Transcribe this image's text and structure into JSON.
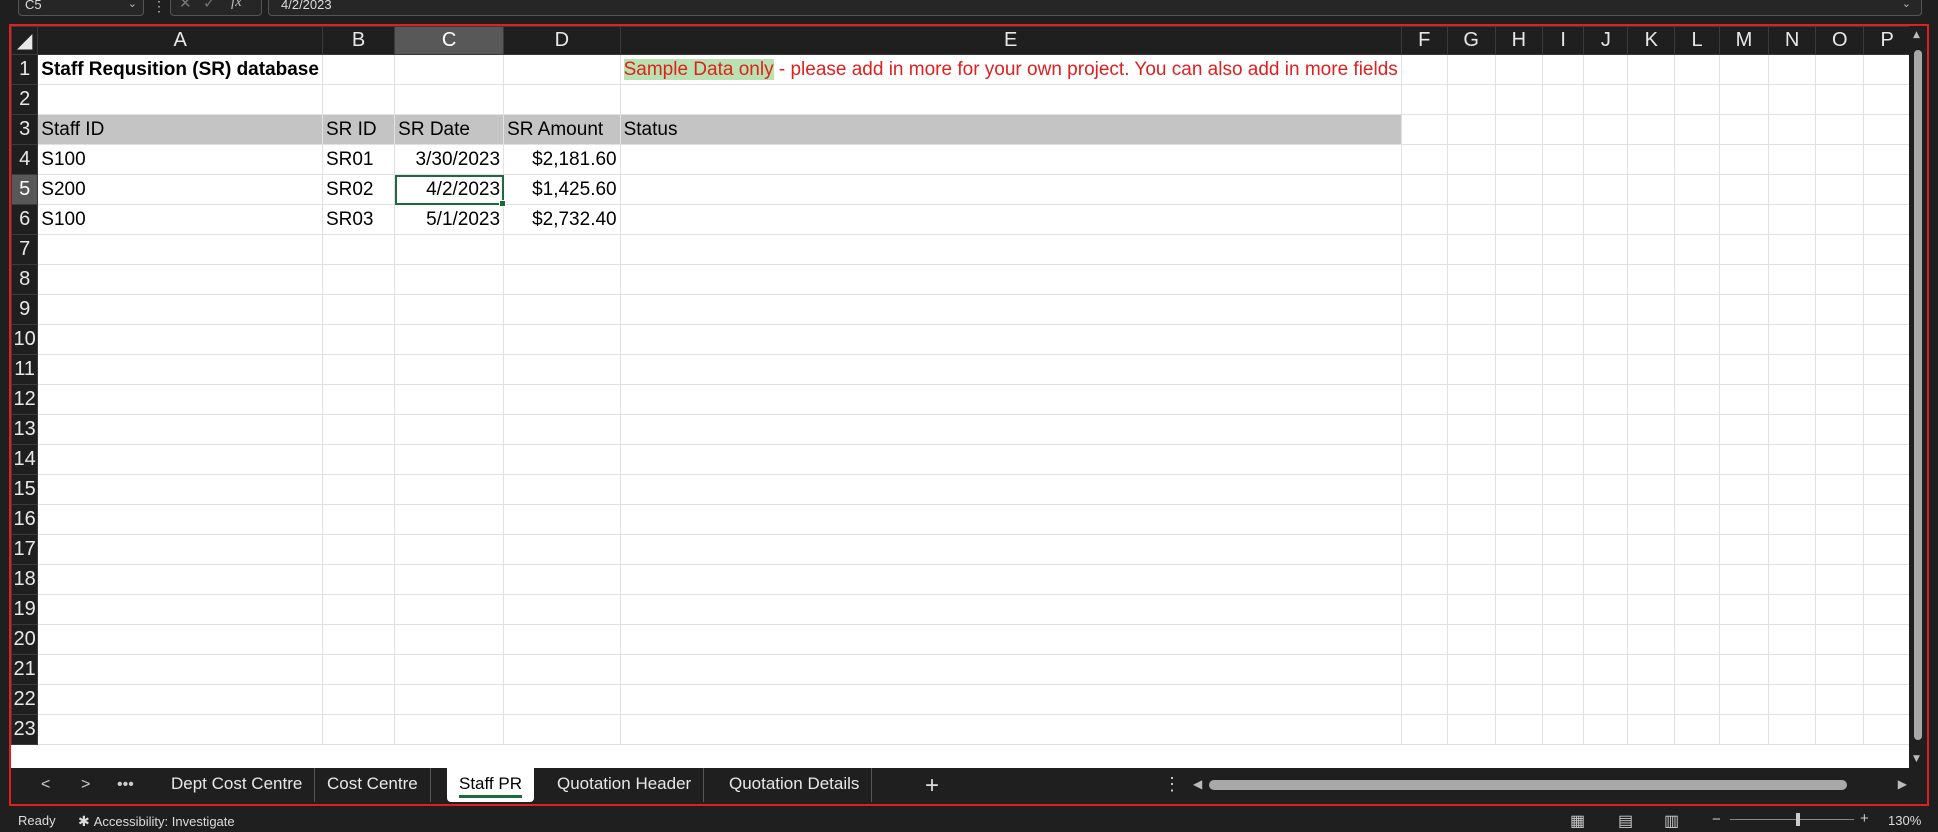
{
  "formula_bar": {
    "name_box": "C5",
    "cancel_icon": "✕",
    "enter_icon": "✓",
    "fx_label": "fx",
    "formula": "4/2/2023"
  },
  "columns": [
    "A",
    "B",
    "C",
    "D",
    "E",
    "F",
    "G",
    "H",
    "I",
    "J",
    "K",
    "L",
    "M",
    "N",
    "O",
    "P"
  ],
  "selected_column": "C",
  "selected_row": 5,
  "rows": [
    "1",
    "2",
    "3",
    "4",
    "5",
    "6",
    "7",
    "8",
    "9",
    "10",
    "11",
    "12",
    "13",
    "14",
    "15",
    "16",
    "17",
    "18",
    "19",
    "20",
    "21",
    "22",
    "23"
  ],
  "sheet": {
    "title": "Staff Requsition (SR) database",
    "note_part1": "Sample Data only",
    "note_part2": " - please add in more for your own project. You can also add in more fields",
    "headers": [
      "Staff ID",
      "SR ID",
      "SR Date",
      "SR Amount",
      "Status"
    ],
    "records": [
      [
        "S100",
        "SR01",
        "3/30/2023",
        "$2,181.60",
        ""
      ],
      [
        "S200",
        "SR02",
        "4/2/2023",
        "$1,425.60",
        ""
      ],
      [
        "S100",
        "SR03",
        "5/1/2023",
        "$2,732.40",
        ""
      ]
    ]
  },
  "tabs": {
    "items": [
      "Dept Cost Centre",
      "Cost Centre",
      "Staff PR",
      "Quotation Header",
      "Quotation Details"
    ],
    "active": "Staff PR",
    "add": "+"
  },
  "status": {
    "ready": "Ready",
    "accessibility": "Accessibility: Investigate",
    "zoom": "130%"
  },
  "colors": {
    "accent": "#1d6b3a",
    "note_text": "#e02020",
    "header_fill": "#c4c4c4",
    "note_fill": "#b9e2b0"
  }
}
